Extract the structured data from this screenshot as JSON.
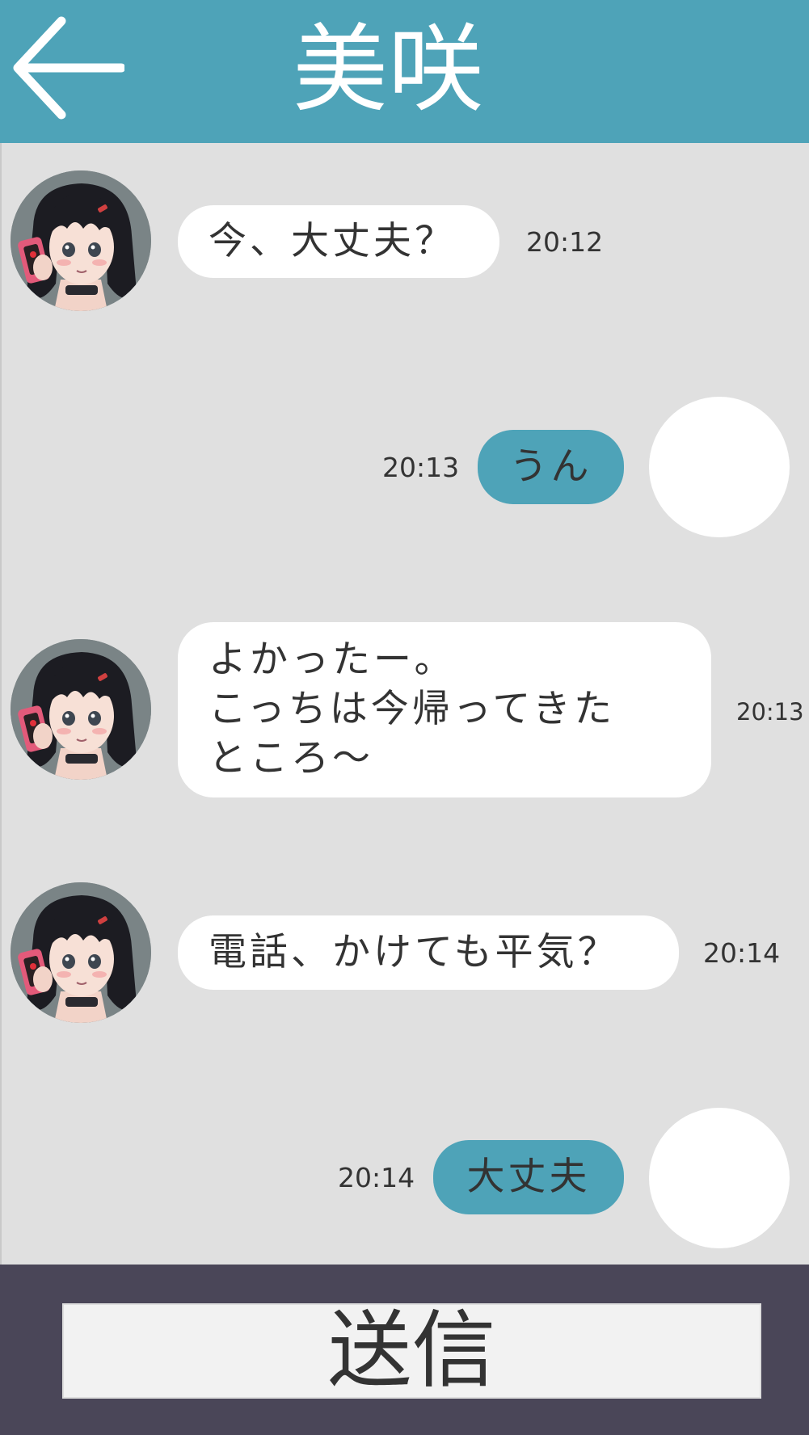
{
  "header": {
    "title": "美咲",
    "back_icon": "arrow-left-icon",
    "background_color": "#4ea3b8"
  },
  "messages": [
    {
      "sender": "partner",
      "text": "今、大丈夫？",
      "time": "20:12"
    },
    {
      "sender": "me",
      "text": "うん",
      "time": "20:13"
    },
    {
      "sender": "partner",
      "text": "よかったー。\nこっちは今帰ってきた\nところ〜",
      "time": "20:13"
    },
    {
      "sender": "partner",
      "text": "電話、かけても平気？",
      "time": "20:14"
    },
    {
      "sender": "me",
      "text": "大丈夫",
      "time": "20:14"
    }
  ],
  "footer": {
    "send_label": "送信",
    "background_color": "#4a4658"
  },
  "colors": {
    "chat_background": "#e0e0e0",
    "partner_bubble": "#ffffff",
    "my_bubble": "#4ea3b8",
    "text": "#333333"
  }
}
